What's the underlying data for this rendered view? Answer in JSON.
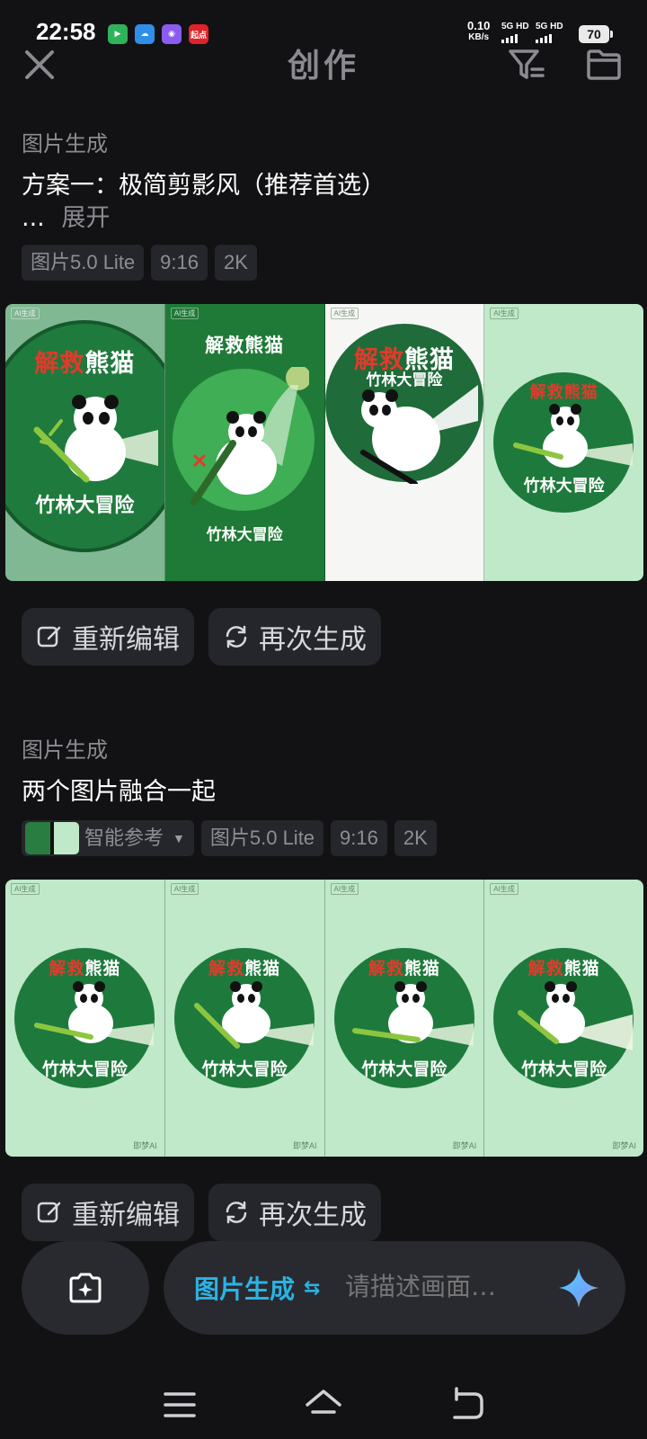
{
  "status_bar": {
    "time": "22:58",
    "app_icons": [
      {
        "name": "video-app-icon",
        "label": "",
        "color": "#2fb35a"
      },
      {
        "name": "cloud-app-icon",
        "label": "",
        "color": "#2f8fe8"
      },
      {
        "name": "chat-app-icon",
        "label": "",
        "color": "#8a5cf0"
      },
      {
        "name": "qidian-app-icon",
        "label": "起点",
        "color": "#e0222a"
      }
    ],
    "net_speed_value": "0.10",
    "net_speed_unit": "KB/s",
    "signal_1": "5G HD",
    "signal_2": "5G HD",
    "battery": "70"
  },
  "header": {
    "title": "创作"
  },
  "section1": {
    "label": "图片生成",
    "prompt": "方案一：极简剪影风（推荐首选）",
    "ellipsis": "...",
    "expand": "展开",
    "tags": [
      "图片5.0 Lite",
      "9:16",
      "2K"
    ],
    "ai_mark": "AI生成",
    "images": [
      {
        "title_red": "解救",
        "title_white": "熊猫",
        "subtitle": "竹林大冒险"
      },
      {
        "title_red": "",
        "title_white": "解救熊猫",
        "subtitle": "竹林大冒险"
      },
      {
        "title_red": "解救",
        "title_white": "熊猫",
        "subtitle": "竹林大冒险"
      },
      {
        "title_red": "解救熊猫",
        "title_white": "",
        "subtitle": "竹林大冒险"
      }
    ],
    "edit_label": "重新编辑",
    "regenerate_label": "再次生成"
  },
  "section2": {
    "label": "图片生成",
    "prompt": "两个图片融合一起",
    "reference_label": "智能参考",
    "tags": [
      "图片5.0 Lite",
      "9:16",
      "2K"
    ],
    "ai_mark": "AI生成",
    "brand_mark": "即梦AI",
    "images": [
      {
        "title_red": "解救",
        "title_white": "熊猫",
        "subtitle": "竹林大冒险"
      },
      {
        "title_red": "解救",
        "title_white": "熊猫",
        "subtitle": "竹林大冒险"
      },
      {
        "title_red": "解救",
        "title_white": "熊猫",
        "subtitle": "竹林大冒险"
      },
      {
        "title_red": "解救",
        "title_white": "熊猫",
        "subtitle": "竹林大冒险"
      }
    ],
    "edit_label": "重新编辑",
    "regenerate_label": "再次生成"
  },
  "composer": {
    "mode": "图片生成",
    "mode_swap_icon": "⇆",
    "placeholder": "请描述画面…"
  },
  "colors": {
    "background": "#121214",
    "chip": "#25262b",
    "accent": "#2bb3e3",
    "poster_green": "#1e7a3c",
    "poster_mint": "#bfe9c9",
    "title_red": "#e33a2b"
  }
}
